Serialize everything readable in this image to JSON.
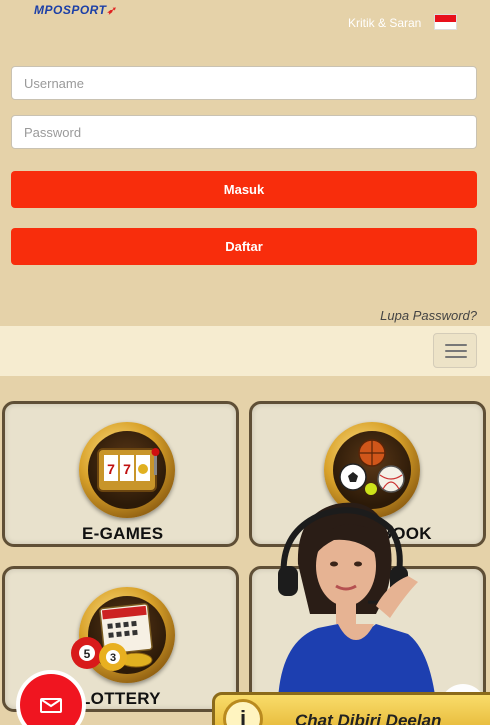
{
  "header": {
    "logo_mpo": "MPO",
    "logo_sport": "SPORT",
    "kritik": "Kritik & Saran"
  },
  "login": {
    "username_placeholder": "Username",
    "password_placeholder": "Password",
    "masuk_label": "Masuk",
    "daftar_label": "Daftar",
    "lupa_password": "Lupa Password?"
  },
  "categories": [
    {
      "label": "E-GAMES"
    },
    {
      "label": "SBOOK"
    },
    {
      "label": "LOTTERY"
    }
  ],
  "chat": {
    "label": "Chat Dibiri Deelan"
  },
  "colors": {
    "background": "#e5d2a9",
    "button": "#f82d0c",
    "navband": "#f6ecd0",
    "card_border": "#5f4f36"
  }
}
